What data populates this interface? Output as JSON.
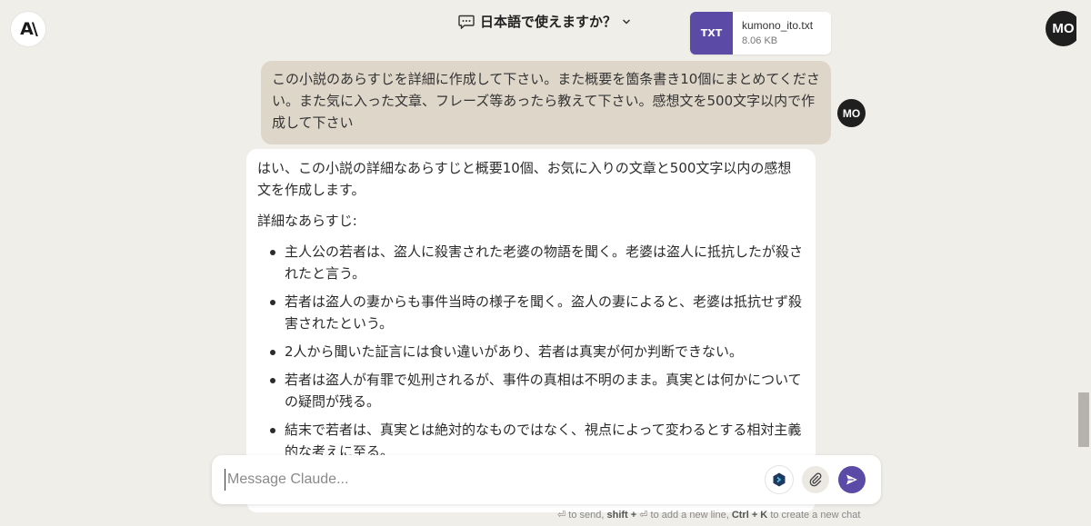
{
  "header": {
    "logo_text": "A\\",
    "title": "日本語で使えますか？",
    "chat_icon": "chat-bubble-icon",
    "chevron_icon": "chevron-down-icon",
    "avatar_initials": "MO"
  },
  "attachment": {
    "type": "TXT",
    "name": "kumono_ito.txt",
    "size": "8.06 KB",
    "color": "#5b4aa6"
  },
  "user_message": {
    "text": "この小説のあらすじを詳細に作成して下さい。また概要を箇条書き10個にまとめてください。また気に入った文章、フレーズ等あったら教えて下さい。感想文を500文字以内で作成して下さい",
    "avatar_initials": "MO"
  },
  "assistant_message": {
    "intro": "はい、この小説の詳細なあらすじと概要10個、お気に入りの文章と500文字以内の感想文を作成します。",
    "section_heading": "詳細なあらすじ:",
    "bullets": [
      "主人公の若者は、盗人に殺害された老婆の物語を聞く。老婆は盗人に抵抗したが殺されたと言う。",
      "若者は盗人の妻からも事件当時の様子を聞く。盗人の妻によると、老婆は抵抗せず殺害されたという。",
      "2人から聞いた証言には食い違いがあり、若者は真実が何か判断できない。",
      "若者は盗人が有罪で処刑されるが、事件の真相は不明のまま。真実とは何かについての疑問が残る。",
      "結末で若者は、真実とは絶対的なものではなく、視点によって変わるとする相対主義的な考えに至る。"
    ]
  },
  "composer": {
    "placeholder": "Message Claude...",
    "value": "",
    "extension_icon": "extension-cube-icon",
    "attach_icon": "paperclip-icon",
    "send_icon": "send-arrow-icon",
    "accent_color": "#5b4aa6"
  },
  "hint": {
    "enter_glyph": "⏎",
    "to_send": "to send,",
    "shift": "shift +",
    "new_line": "to add a new line,",
    "ctrl_k": "Ctrl + K",
    "new_chat": "to create a new chat"
  }
}
